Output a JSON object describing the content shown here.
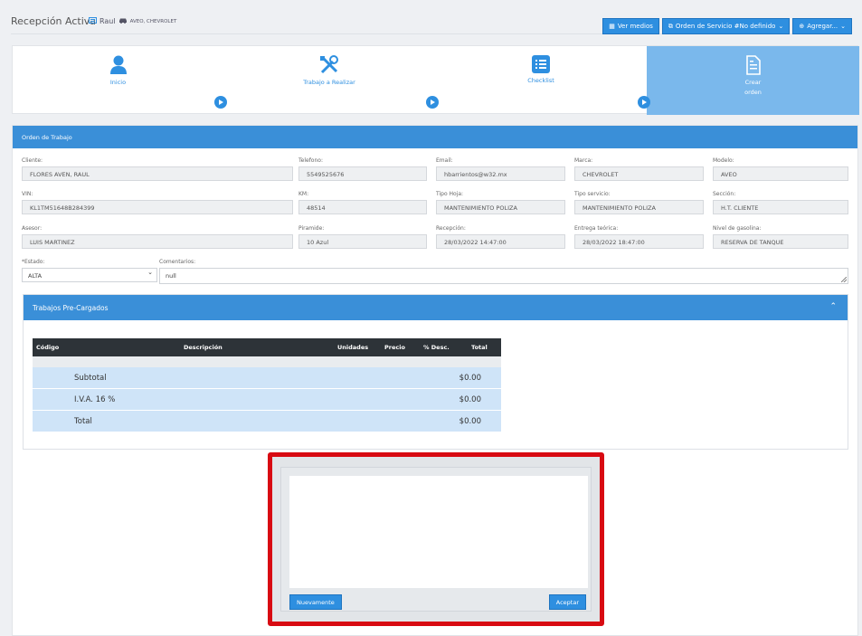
{
  "header": {
    "title": "Recepción Activa",
    "customer": "Raul",
    "vehicle": "AVEO, CHEVROLET",
    "buttons": {
      "media": "Ver medios",
      "order": "Orden de Servicio #No definido",
      "add": "Agregar..."
    }
  },
  "steps": [
    {
      "label": "Inicio"
    },
    {
      "label": "Trabajo a Realizar"
    },
    {
      "label": "Checklist"
    },
    {
      "label1": "Crear",
      "label2": "orden"
    }
  ],
  "work_order": {
    "title": "Orden de Trabajo",
    "fields": {
      "cliente": {
        "label": "Cliente:",
        "value": "FLORES AVEN, RAUL"
      },
      "telefono": {
        "label": "Telefono:",
        "value": "5549525676"
      },
      "email": {
        "label": "Email:",
        "value": "hbarrientos@w32.mx"
      },
      "marca": {
        "label": "Marca:",
        "value": "CHEVROLET"
      },
      "modelo": {
        "label": "Modelo:",
        "value": "AVEO"
      },
      "vin": {
        "label": "VIN:",
        "value": "KL1TM51648B284399"
      },
      "km": {
        "label": "KM:",
        "value": "48514"
      },
      "tipo_hoja": {
        "label": "Tipo Hoja:",
        "value": "MANTENIMIENTO POLIZA"
      },
      "tipo_servicio": {
        "label": "Tipo servicio:",
        "value": "MANTENIMIENTO POLIZA"
      },
      "seccion": {
        "label": "Sección:",
        "value": "H.T. CLIENTE"
      },
      "asesor": {
        "label": "Asesor:",
        "value": "LUIS MARTINEZ"
      },
      "piramide": {
        "label": "Piramide:",
        "value": "10 Azul"
      },
      "recepcion": {
        "label": "Recepción:",
        "value": "28/03/2022 14:47:00"
      },
      "entrega": {
        "label": "Entrega teórica:",
        "value": "28/03/2022 18:47:00"
      },
      "gasolina": {
        "label": "Nivel de gasolina:",
        "value": "RESERVA DE TANQUE"
      },
      "estado": {
        "label": "*Estado:",
        "value": "ALTA"
      },
      "comentarios": {
        "label": "Comentarios:",
        "value": "null"
      }
    }
  },
  "preloaded": {
    "title": "Trabajos Pre-Cargados",
    "columns": [
      "Código",
      "Descripción",
      "Unidades",
      "Precio",
      "% Desc.",
      "Total"
    ],
    "totals": [
      {
        "label": "Subtotal",
        "value": "$0.00"
      },
      {
        "label": "I.V.A. 16 %",
        "value": "$0.00"
      },
      {
        "label": "Total",
        "value": "$0.00"
      }
    ]
  },
  "signature_modal": {
    "retry": "Nuevamente",
    "accept": "Aceptar"
  }
}
